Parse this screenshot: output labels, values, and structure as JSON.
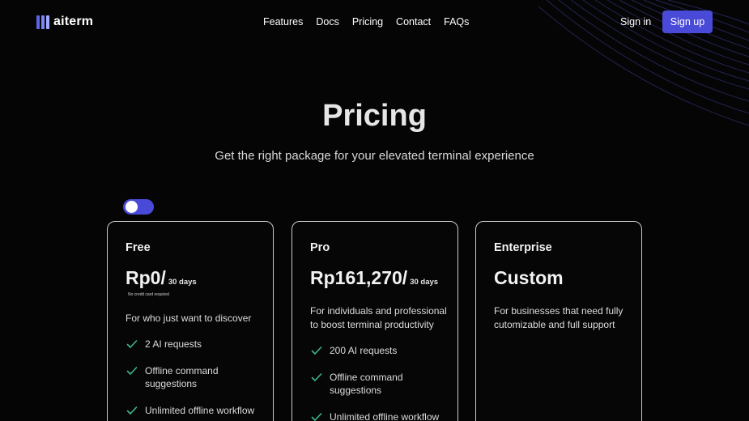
{
  "brand": {
    "name": "aiterm",
    "accent": "#4a4ad9"
  },
  "nav": {
    "items": [
      "Features",
      "Docs",
      "Pricing",
      "Contact",
      "FAQs"
    ]
  },
  "auth": {
    "signin_label": "Sign in",
    "signup_label": "Sign up"
  },
  "hero": {
    "title": "Pricing",
    "subtitle": "Get the right package for your elevated terminal experience"
  },
  "billing_toggle": {
    "state": "on"
  },
  "plans": [
    {
      "name": "Free",
      "price": "Rp0/",
      "period": "30 days",
      "note": "No credit card required",
      "description": "For who just want to discover",
      "features": [
        "2 AI requests",
        "Offline command suggestions",
        "Unlimited offline workflow"
      ]
    },
    {
      "name": "Pro",
      "price": "Rp161,270/",
      "period": "30 days",
      "description": "For individuals and professional to boost terminal productivity",
      "features": [
        "200 AI requests",
        "Offline command suggestions",
        "Unlimited offline workflow"
      ]
    },
    {
      "name": "Enterprise",
      "price": "Custom",
      "description": "For businesses that need fully cutomizable and full support",
      "features": []
    }
  ],
  "icons": {
    "check": "check-icon",
    "logo": "logo-icon"
  }
}
